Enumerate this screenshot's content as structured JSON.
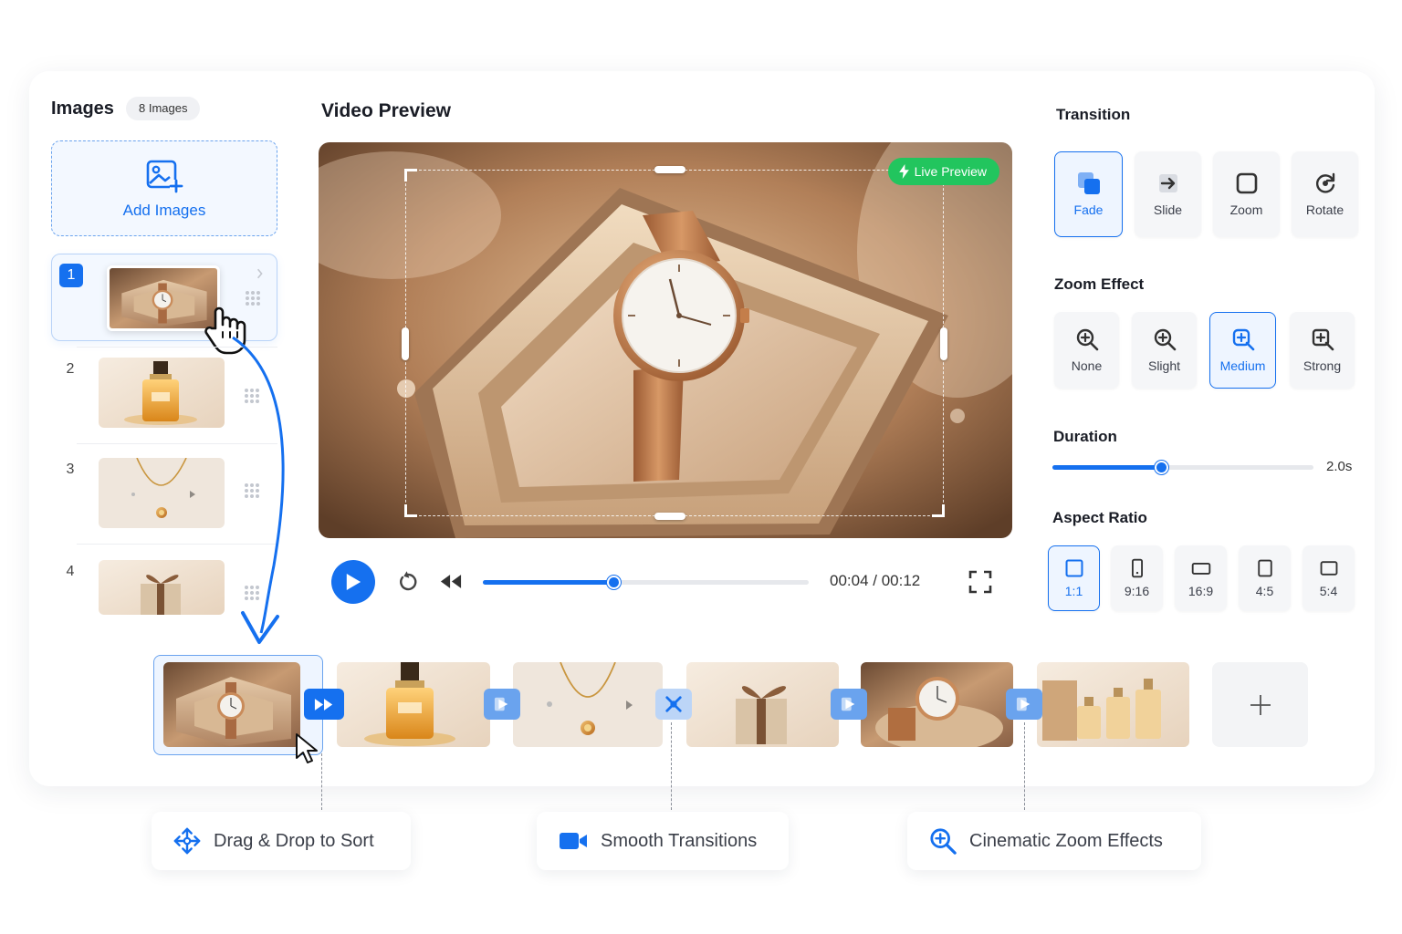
{
  "images_panel": {
    "title": "Images",
    "count": "8 Images",
    "add_label": "Add Images",
    "items": [
      {
        "num": "1",
        "subject": "watch"
      },
      {
        "num": "2",
        "subject": "perfume"
      },
      {
        "num": "3",
        "subject": "necklace"
      },
      {
        "num": "4",
        "subject": "gift box"
      }
    ]
  },
  "preview": {
    "title": "Video Preview",
    "live_badge": "Live Preview",
    "time": "00:04 / 00:12",
    "progress": 0.4
  },
  "transition": {
    "title": "Transition",
    "options": [
      "Fade",
      "Slide",
      "Zoom",
      "Rotate"
    ],
    "selected": "Fade"
  },
  "zoom_effect": {
    "title": "Zoom Effect",
    "options": [
      "None",
      "Slight",
      "Medium",
      "Strong"
    ],
    "selected": "Medium"
  },
  "duration": {
    "title": "Duration",
    "value": "2.0s",
    "level": 0.4
  },
  "aspect_ratio": {
    "title": "Aspect Ratio",
    "options": [
      "1:1",
      "9:16",
      "16:9",
      "4:5",
      "5:4"
    ],
    "selected": "1:1"
  },
  "features": [
    {
      "label": "Drag & Drop to Sort",
      "icon": "drag-arrows-icon"
    },
    {
      "label": "Smooth Transitions",
      "icon": "video-camera-icon"
    },
    {
      "label": "Cinematic Zoom Effects",
      "icon": "zoom-in-icon"
    }
  ],
  "colors": {
    "accent": "#1570ef",
    "live": "#22c55e"
  }
}
